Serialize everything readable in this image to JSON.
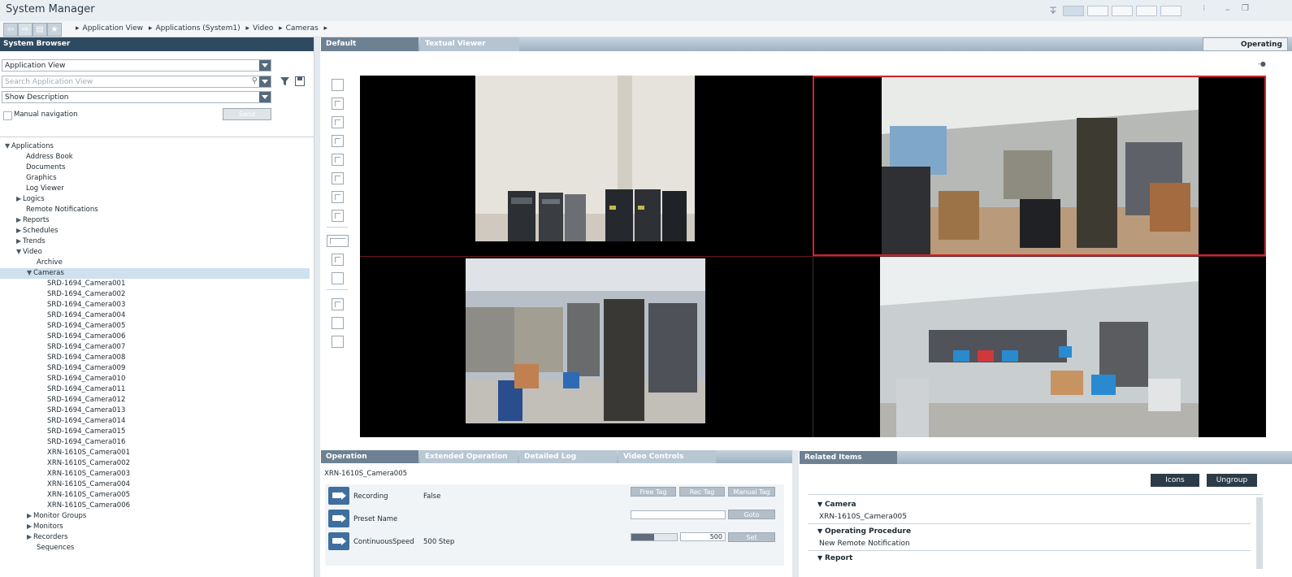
{
  "window": {
    "title": "System Manager"
  },
  "breadcrumb": [
    "Application View",
    "Applications (System1)",
    "Video",
    "Cameras"
  ],
  "left": {
    "header": "System Browser",
    "view_select": "Application View",
    "search_placeholder": "Search Application View",
    "description_select": "Show Description",
    "manual_nav_label": "Manual navigation",
    "send_label": "Send"
  },
  "tree": {
    "applications": "Applications",
    "address_book": "Address Book",
    "documents": "Documents",
    "graphics": "Graphics",
    "log_viewer": "Log Viewer",
    "logics": "Logics",
    "remote_notifications": "Remote Notifications",
    "reports": "Reports",
    "schedules": "Schedules",
    "trends": "Trends",
    "video": "Video",
    "archive": "Archive",
    "cameras": "Cameras",
    "camera_items": [
      "SRD-1694_Camera001",
      "SRD-1694_Camera002",
      "SRD-1694_Camera003",
      "SRD-1694_Camera004",
      "SRD-1694_Camera005",
      "SRD-1694_Camera006",
      "SRD-1694_Camera007",
      "SRD-1694_Camera008",
      "SRD-1694_Camera009",
      "SRD-1694_Camera010",
      "SRD-1694_Camera011",
      "SRD-1694_Camera012",
      "SRD-1694_Camera013",
      "SRD-1694_Camera014",
      "SRD-1694_Camera015",
      "SRD-1694_Camera016",
      "XRN-1610S_Camera001",
      "XRN-1610S_Camera002",
      "XRN-1610S_Camera003",
      "XRN-1610S_Camera004",
      "XRN-1610S_Camera005",
      "XRN-1610S_Camera006"
    ],
    "monitor_groups": "Monitor Groups",
    "monitors": "Monitors",
    "recorders": "Recorders",
    "sequences": "Sequences"
  },
  "main": {
    "tabs": [
      "Default",
      "Textual Viewer"
    ],
    "mode_button": "Operating"
  },
  "operation": {
    "tabs": [
      "Operation",
      "Extended Operation",
      "Detailed Log",
      "Video Controls"
    ],
    "object_name": "XRN-1610S_Camera005",
    "rows": {
      "recording_label": "Recording",
      "recording_value": "False",
      "preset_label": "Preset Name",
      "speed_label": "ContinuousSpeed",
      "speed_value": "500 Step",
      "speed_input": "500",
      "speed_slider_fraction": 0.5
    },
    "buttons": {
      "free_tag": "Free Tag",
      "rec_tag": "Rec Tag",
      "manual_tag": "Manual Tag",
      "goto": "Goto",
      "set": "Set"
    }
  },
  "related": {
    "header": "Related Items",
    "icons_button": "Icons",
    "ungroup_button": "Ungroup",
    "sections": {
      "camera": "Camera",
      "camera_value": "XRN-1610S_Camera005",
      "procedure": "Operating Procedure",
      "procedure_value": "New Remote Notification",
      "report": "Report"
    }
  }
}
